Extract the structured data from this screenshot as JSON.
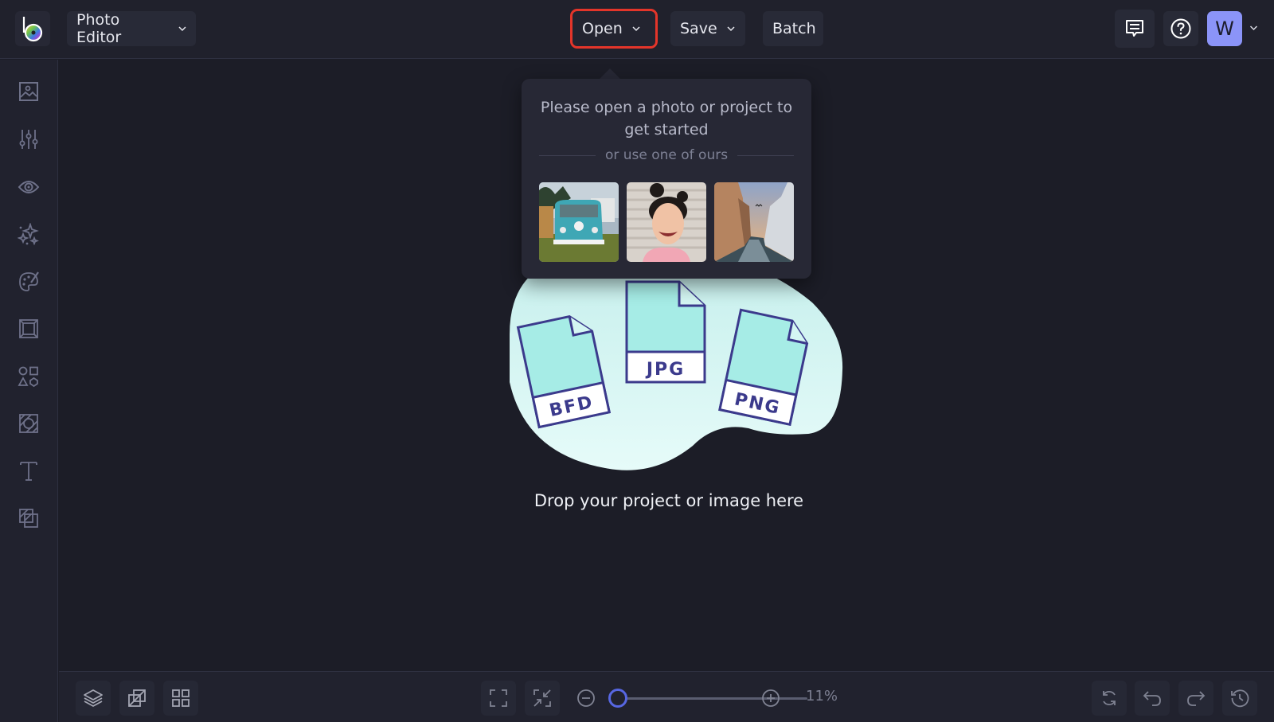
{
  "topbar": {
    "logo_icon": "befunky-logo-icon",
    "app_mode_label": "Photo Editor",
    "open_label": "Open",
    "save_label": "Save",
    "batch_label": "Batch",
    "feedback_icon": "chat-feedback-icon",
    "help_icon": "question-circle-icon",
    "avatar_letter": "W"
  },
  "sidebar": {
    "items": [
      {
        "id": "image-manager",
        "icon": "image-icon"
      },
      {
        "id": "edit",
        "icon": "sliders-icon"
      },
      {
        "id": "touch-up",
        "icon": "eye-icon"
      },
      {
        "id": "effects",
        "icon": "sparkles-icon"
      },
      {
        "id": "artsy",
        "icon": "palette-icon"
      },
      {
        "id": "frames",
        "icon": "frame-icon"
      },
      {
        "id": "graphics",
        "icon": "shapes-icon"
      },
      {
        "id": "overlays",
        "icon": "texture-icon"
      },
      {
        "id": "text",
        "icon": "text-icon"
      },
      {
        "id": "textures",
        "icon": "layers-blend-icon"
      }
    ]
  },
  "popover": {
    "title": "Please open a photo or project to get started",
    "subtitle": "or use one of ours",
    "samples": [
      {
        "name": "sample-vw-bus"
      },
      {
        "name": "sample-woman-portrait"
      },
      {
        "name": "sample-venice-canal"
      }
    ]
  },
  "drop_zone": {
    "files": [
      "BFD",
      "JPG",
      "PNG"
    ],
    "text": "Drop your project or image here",
    "colors": {
      "blob": "#dff8f6",
      "file_fill": "#a6ece6",
      "file_stroke": "#3b3a8c"
    }
  },
  "bottombar": {
    "zoom_percent_label": "11%",
    "zoom_value_percent": 11
  },
  "colors": {
    "accent": "#5767e2",
    "highlight_box": "#e4352a",
    "avatar": "#8b94f8"
  }
}
